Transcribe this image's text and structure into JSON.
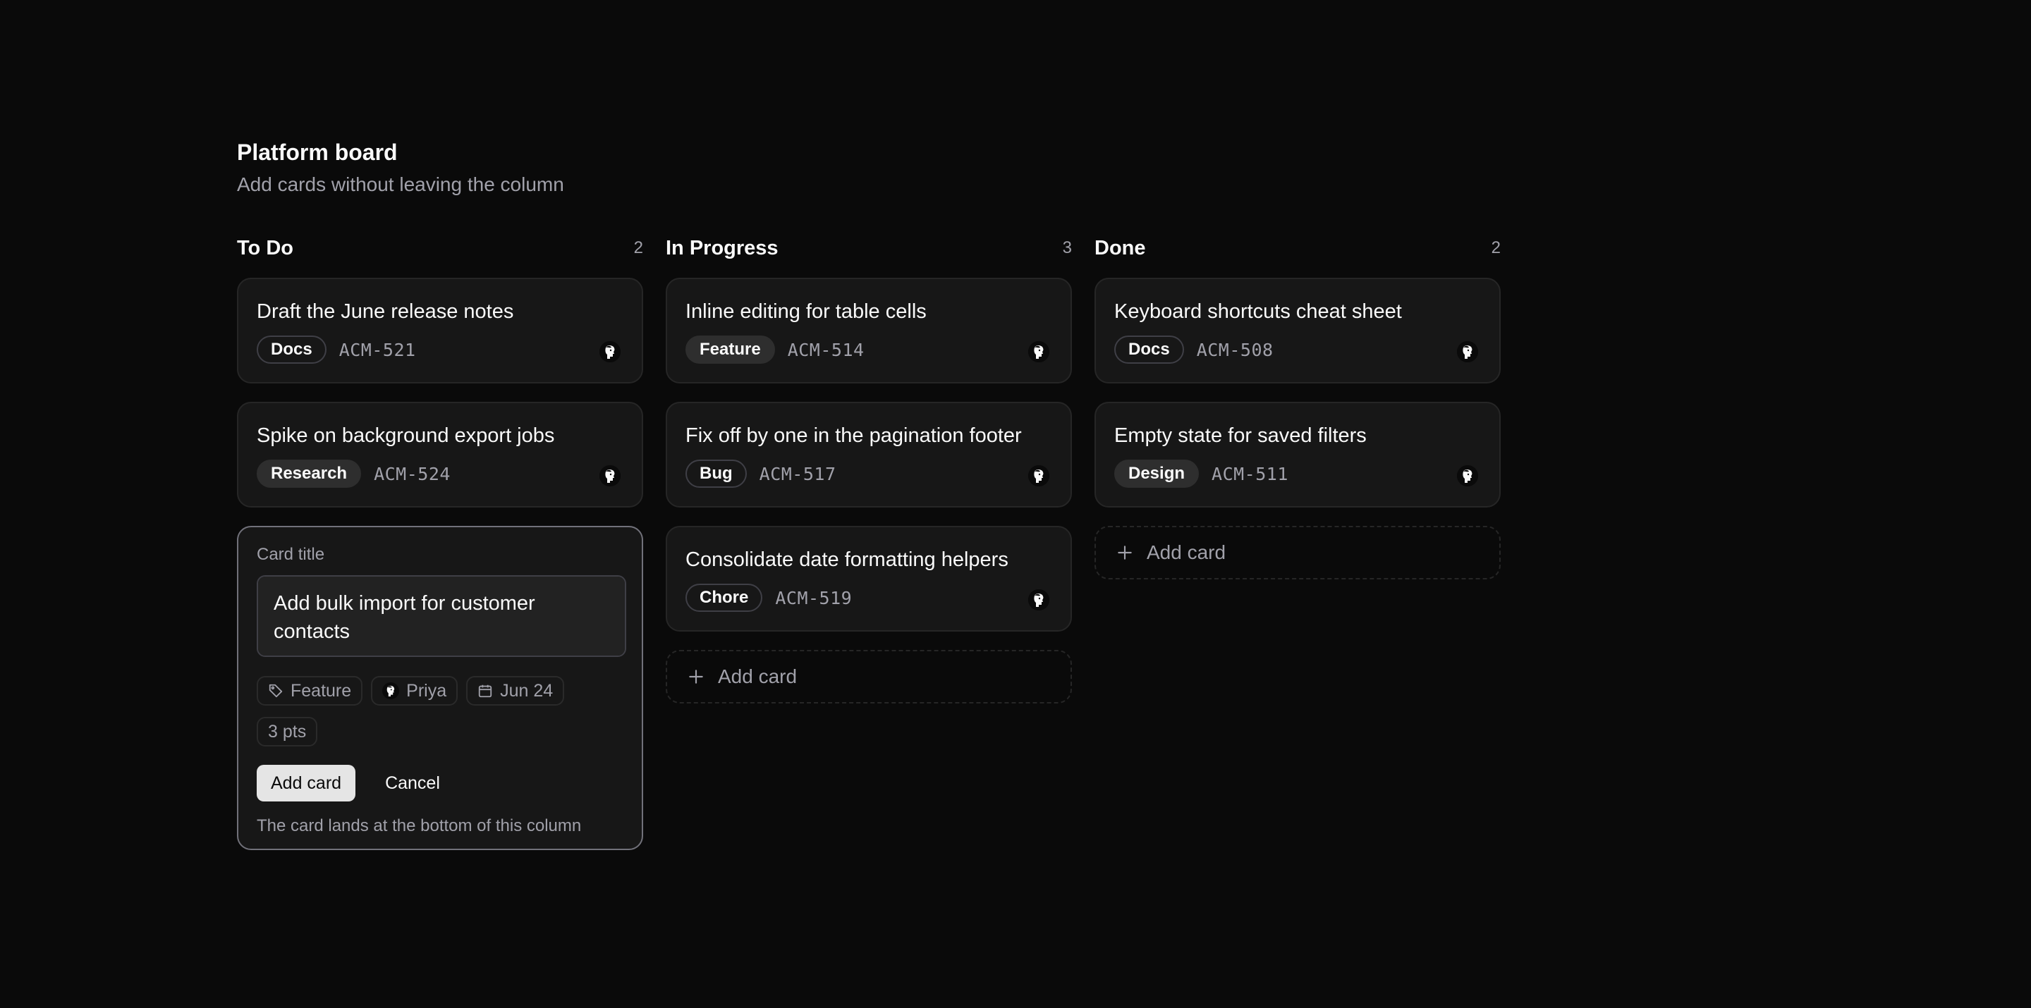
{
  "board": {
    "title": "Platform board",
    "subtitle": "Add cards without leaving the column"
  },
  "columns": [
    {
      "title": "To Do",
      "count": "2",
      "cards": [
        {
          "title": "Draft the June release notes",
          "tag": "Docs",
          "tag_style": "outline",
          "id": "ACM-521",
          "avatar": "avatar-face-icon"
        },
        {
          "title": "Spike on background export jobs",
          "tag": "Research",
          "tag_style": "filled",
          "id": "ACM-524",
          "avatar": "avatar-face-icon"
        }
      ]
    },
    {
      "title": "In Progress",
      "count": "3",
      "cards": [
        {
          "title": "Inline editing for table cells",
          "tag": "Feature",
          "tag_style": "filled",
          "id": "ACM-514",
          "avatar": "avatar-face-icon"
        },
        {
          "title": "Fix off by one in the pagination footer",
          "tag": "Bug",
          "tag_style": "outline",
          "id": "ACM-517",
          "avatar": "avatar-face-icon"
        },
        {
          "title": "Consolidate date formatting helpers",
          "tag": "Chore",
          "tag_style": "outline",
          "id": "ACM-519",
          "avatar": "avatar-face-icon"
        }
      ],
      "add_card_label": "Add card"
    },
    {
      "title": "Done",
      "count": "2",
      "cards": [
        {
          "title": "Keyboard shortcuts cheat sheet",
          "tag": "Docs",
          "tag_style": "outline",
          "id": "ACM-508",
          "avatar": "avatar-face-icon"
        },
        {
          "title": "Empty state for saved filters",
          "tag": "Design",
          "tag_style": "filled",
          "id": "ACM-511",
          "avatar": "avatar-face-icon"
        }
      ],
      "add_card_label": "Add card"
    }
  ],
  "composer": {
    "label": "Card title",
    "value": "Add bulk import for customer contacts",
    "chips": {
      "label": "Feature",
      "assignee": "Priya",
      "due": "Jun 24",
      "points": "3 pts"
    },
    "submit_label": "Add card",
    "cancel_label": "Cancel",
    "hint": "The card lands at the bottom of this column"
  },
  "icons": {
    "tag": "tag-icon",
    "calendar": "calendar-icon",
    "plus": "plus-icon",
    "avatar": "avatar-face-icon"
  },
  "colors": {
    "background": "#0a0a0a",
    "card": "#171717",
    "border": "#262626",
    "muted_text": "#a1a1aa",
    "primary_button": "#e5e5e5"
  }
}
